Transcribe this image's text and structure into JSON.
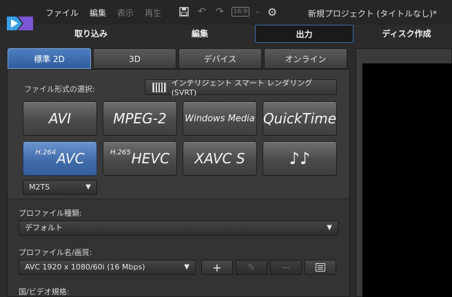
{
  "menu": {
    "file": "ファイル",
    "edit": "編集",
    "view": "表示",
    "play": "再生"
  },
  "toolbar": {
    "aspect": "16:9",
    "icons": [
      "save-icon",
      "undo-icon",
      "redo-icon",
      "aspect-ratio-icon",
      "settings-gear-icon"
    ]
  },
  "window_title": "新規プロジェクト (タイトルなし)*",
  "modes": [
    {
      "label": "取り込み",
      "active": false
    },
    {
      "label": "編集",
      "active": false
    },
    {
      "label": "出力",
      "active": true
    },
    {
      "label": "ディスク作成",
      "active": false
    }
  ],
  "subtabs": [
    {
      "label": "標準 2D",
      "active": true
    },
    {
      "label": "3D",
      "active": false
    },
    {
      "label": "デバイス",
      "active": false
    },
    {
      "label": "オンライン",
      "active": false
    }
  ],
  "file_format": {
    "label": "ファイル形式の選択:",
    "svrt_button": "インテリジェント スマート レンダリング (SVRT)",
    "formats": [
      {
        "label": "AVI",
        "prefix": ""
      },
      {
        "label": "MPEG-2",
        "prefix": ""
      },
      {
        "label": "Windows Media",
        "prefix": ""
      },
      {
        "label": "QuickTime",
        "prefix": ""
      },
      {
        "label": "AVC",
        "prefix": "H.264",
        "selected": true
      },
      {
        "label": "HEVC",
        "prefix": "H.265"
      },
      {
        "label": "XAVC S",
        "prefix": ""
      },
      {
        "label": "♪♪",
        "prefix": ""
      }
    ],
    "container": "M2TS"
  },
  "profile": {
    "type_label": "プロファイル種類:",
    "type_value": "デフォルト",
    "name_label": "プロファイル名/画質:",
    "name_value": "AVC 1920 x 1080/60i (16 Mbps)",
    "add": "+",
    "remove": "—",
    "region_label": "国/ビデオ規格:"
  },
  "colors": {
    "accent": "#3e6aa8",
    "background": "#2b2b2b",
    "preview": "#000000"
  }
}
